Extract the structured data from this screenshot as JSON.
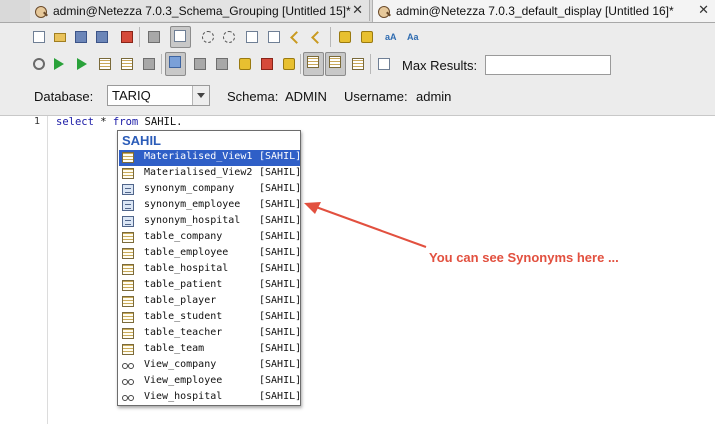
{
  "tabs": [
    {
      "title": "admin@Netezza 7.0.3_Schema_Grouping [Untitled 15]*"
    },
    {
      "title": "admin@Netezza 7.0.3_default_display [Untitled 16]*"
    }
  ],
  "toolbar": {
    "max_results_label": "Max Results:",
    "max_results_value": ""
  },
  "connection": {
    "database_label": "Database:",
    "database_value": "TARIQ",
    "schema_label": "Schema:",
    "schema_value": "ADMIN",
    "username_label": "Username:",
    "username_value": "admin"
  },
  "editor": {
    "line_number": "1",
    "kw_select": "select",
    "star": "*",
    "kw_from": "from",
    "rest": "SAHIL."
  },
  "popup": {
    "header": "SAHIL",
    "items": [
      {
        "name": "Materialised_View1",
        "schema": "[SAHIL]",
        "icon": "table-icon",
        "selected": true
      },
      {
        "name": "Materialised_View2",
        "schema": "[SAHIL]",
        "icon": "table-icon"
      },
      {
        "name": "synonym_company",
        "schema": "[SAHIL]",
        "icon": "synonym-icon"
      },
      {
        "name": "synonym_employee",
        "schema": "[SAHIL]",
        "icon": "synonym-icon"
      },
      {
        "name": "synonym_hospital",
        "schema": "[SAHIL]",
        "icon": "synonym-icon"
      },
      {
        "name": "table_company",
        "schema": "[SAHIL]",
        "icon": "table-icon"
      },
      {
        "name": "table_employee",
        "schema": "[SAHIL]",
        "icon": "table-icon"
      },
      {
        "name": "table_hospital",
        "schema": "[SAHIL]",
        "icon": "table-icon"
      },
      {
        "name": "table_patient",
        "schema": "[SAHIL]",
        "icon": "table-icon"
      },
      {
        "name": "table_player",
        "schema": "[SAHIL]",
        "icon": "table-icon"
      },
      {
        "name": "table_student",
        "schema": "[SAHIL]",
        "icon": "table-icon"
      },
      {
        "name": "table_teacher",
        "schema": "[SAHIL]",
        "icon": "table-icon"
      },
      {
        "name": "table_team",
        "schema": "[SAHIL]",
        "icon": "table-icon"
      },
      {
        "name": "View_company",
        "schema": "[SAHIL]",
        "icon": "view-icon"
      },
      {
        "name": "View_employee",
        "schema": "[SAHIL]",
        "icon": "view-icon"
      },
      {
        "name": "View_hospital",
        "schema": "[SAHIL]",
        "icon": "view-icon"
      }
    ]
  },
  "annotation": {
    "text": "You can see Synonyms here ...",
    "color": "#e2503f"
  }
}
